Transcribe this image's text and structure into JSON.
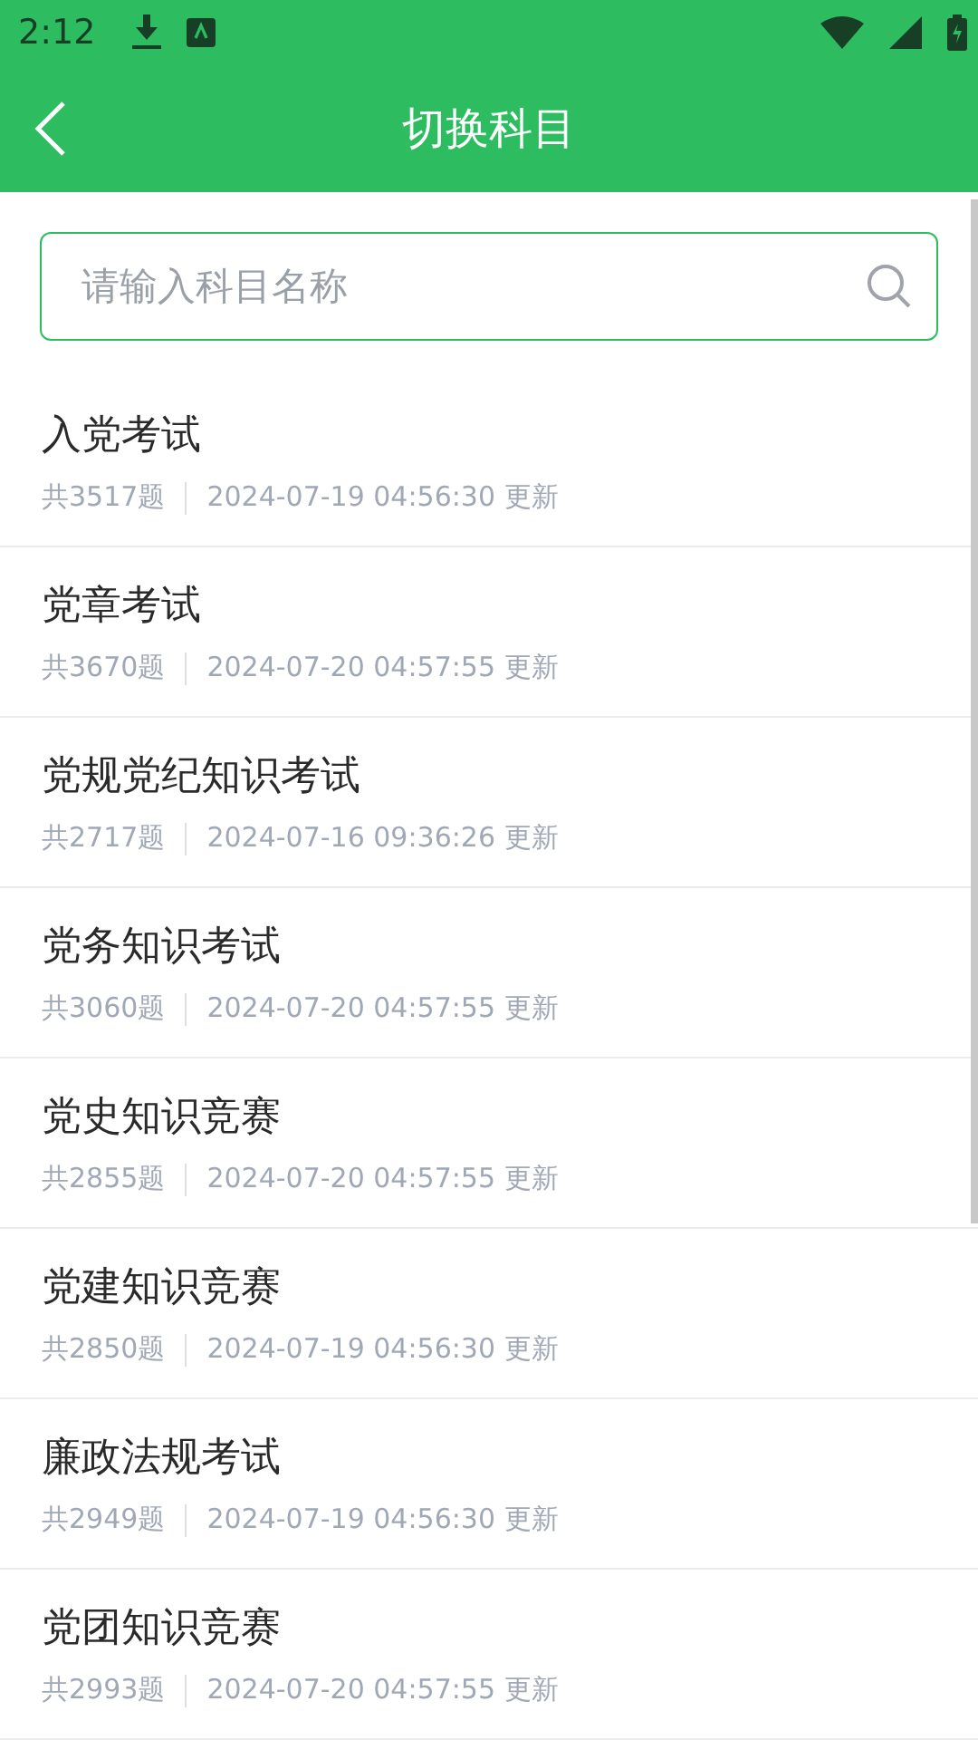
{
  "status_bar": {
    "time": "2:12"
  },
  "header": {
    "title": "切换科目"
  },
  "search": {
    "placeholder": "请输入科目名称"
  },
  "subjects": [
    {
      "name": "入党考试",
      "count": "共3517题",
      "updated": "2024-07-19 04:56:30 更新"
    },
    {
      "name": "党章考试",
      "count": "共3670题",
      "updated": "2024-07-20 04:57:55 更新"
    },
    {
      "name": "党规党纪知识考试",
      "count": "共2717题",
      "updated": "2024-07-16 09:36:26 更新"
    },
    {
      "name": "党务知识考试",
      "count": "共3060题",
      "updated": "2024-07-20 04:57:55 更新"
    },
    {
      "name": "党史知识竞赛",
      "count": "共2855题",
      "updated": "2024-07-20 04:57:55 更新"
    },
    {
      "name": "党建知识竞赛",
      "count": "共2850题",
      "updated": "2024-07-19 04:56:30 更新"
    },
    {
      "name": "廉政法规考试",
      "count": "共2949题",
      "updated": "2024-07-19 04:56:30 更新"
    },
    {
      "name": "党团知识竞赛",
      "count": "共2993题",
      "updated": "2024-07-20 04:57:55 更新"
    }
  ]
}
